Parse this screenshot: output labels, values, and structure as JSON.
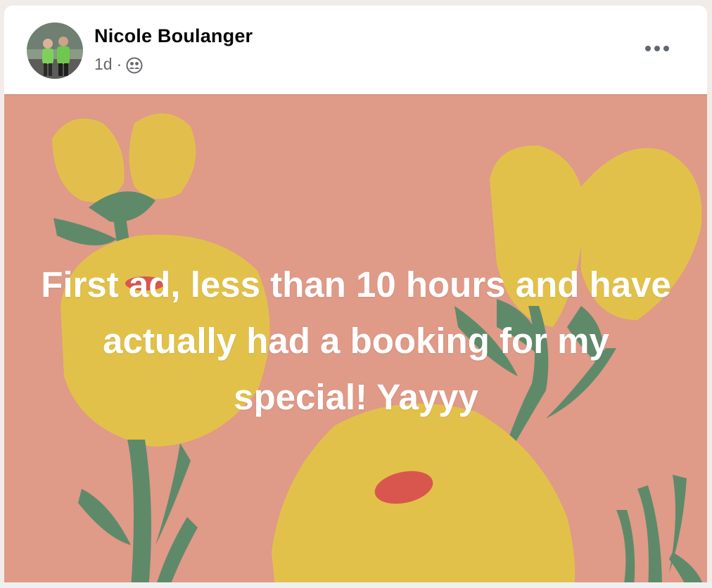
{
  "post": {
    "author_name": "Nicole Boulanger",
    "timestamp": "1d",
    "separator": "·",
    "audience_icon": "friends-icon",
    "more_icon": "more-options-icon",
    "text": "First ad, less than 10 hours and have actually had a booking for my special! Yayyy"
  },
  "colors": {
    "background_card": "#df9a88",
    "flower_yellow": "#e2c14a",
    "leaf_green": "#5f8a6a",
    "flower_dot_red": "#d9564f",
    "text": "#ffffff"
  }
}
